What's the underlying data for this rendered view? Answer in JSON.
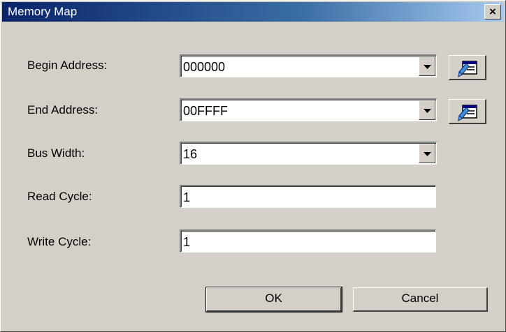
{
  "window": {
    "title": "Memory Map",
    "close_label": "×"
  },
  "form": {
    "begin_address": {
      "label": "Begin Address:",
      "value": "000000"
    },
    "end_address": {
      "label": "End Address:",
      "value": "00FFFF"
    },
    "bus_width": {
      "label": "Bus Width:",
      "value": "16"
    },
    "read_cycle": {
      "label": "Read Cycle:",
      "value": "1"
    },
    "write_cycle": {
      "label": "Write Cycle:",
      "value": "1"
    }
  },
  "buttons": {
    "ok": "OK",
    "cancel": "Cancel"
  },
  "icons": {
    "dropdown": "chevron-down-icon",
    "picker": "address-picker-icon"
  },
  "colors": {
    "titlebar_start": "#0a246a",
    "titlebar_end": "#a6caf0",
    "face": "#d4d0c8"
  }
}
